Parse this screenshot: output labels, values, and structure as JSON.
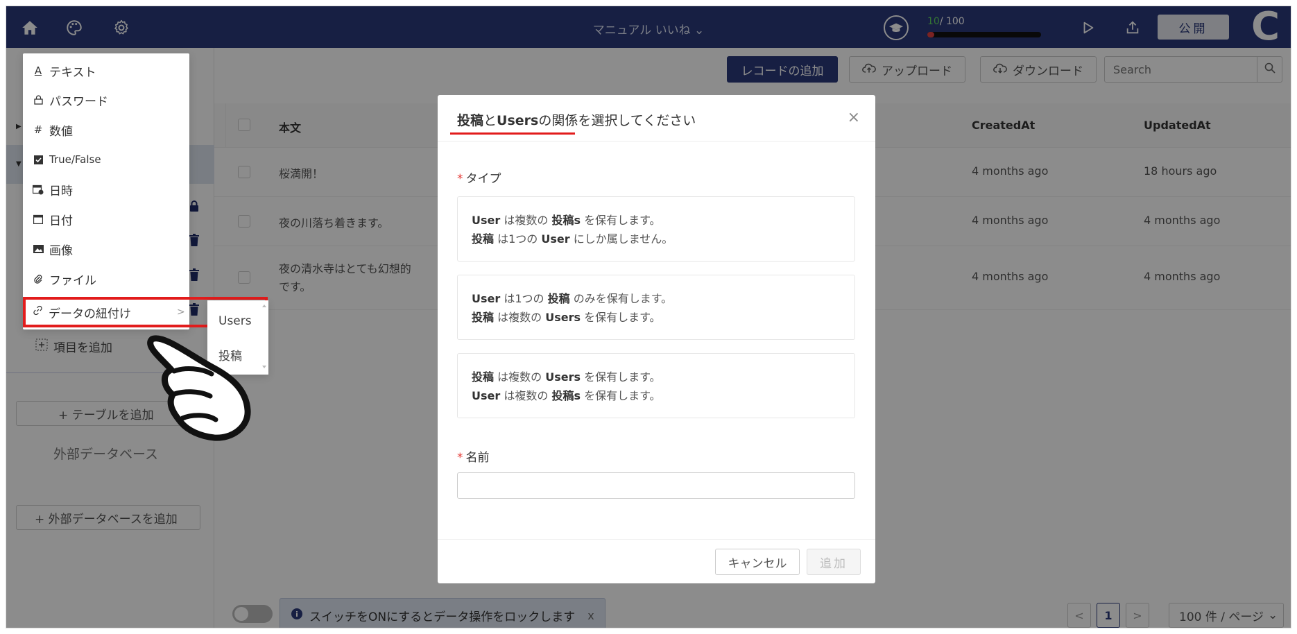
{
  "topbar": {
    "project_title": "マニュアル いいね ⌄",
    "progress": {
      "current": "10",
      "total": "/ 100",
      "fraction": 0.06
    },
    "publish_label": "公開",
    "logo": "C"
  },
  "type_menu": {
    "items": [
      {
        "icon": "text-icon",
        "glyph": "A",
        "label": "テキスト"
      },
      {
        "icon": "lock-icon",
        "glyph": "🔒",
        "label": "パスワード"
      },
      {
        "icon": "hash-icon",
        "glyph": "#",
        "label": "数値"
      },
      {
        "icon": "checkbox-icon",
        "glyph": "☑",
        "label": "True/False"
      },
      {
        "icon": "calendar-clock-icon",
        "glyph": "📅",
        "label": "日時"
      },
      {
        "icon": "calendar-icon",
        "glyph": "📅",
        "label": "日付"
      },
      {
        "icon": "image-icon",
        "glyph": "▣",
        "label": "画像"
      },
      {
        "icon": "paperclip-icon",
        "glyph": "📎",
        "label": "ファイル"
      }
    ],
    "link_item": {
      "label": "データの紐付け",
      "chevron": ">"
    },
    "sub_items": [
      "Users",
      "投稿"
    ]
  },
  "sidebar": {
    "add_item_label": "項目を追加",
    "add_table_label": "+ テーブルを追加",
    "external_db_label": "外部データベース",
    "add_external_db_label": "+ 外部データベースを追加"
  },
  "toolbar": {
    "add_record_label": "レコードの追加",
    "upload_label": "アップロード",
    "download_label": "ダウンロード",
    "search_placeholder": "Search"
  },
  "table": {
    "columns": [
      "本文",
      "CreatedAt",
      "UpdatedAt"
    ],
    "rows": [
      {
        "body": "桜満開！",
        "created": "4 months ago",
        "updated": "18 hours ago"
      },
      {
        "body": "夜の川落ち着きます。",
        "created": "4 months ago",
        "updated": "4 months ago"
      },
      {
        "body": "夜の清水寺はとても幻想的です。",
        "body_line1": "夜の清水寺はとても幻想的",
        "body_line2": "です。",
        "created": "4 months ago",
        "updated": "4 months ago"
      }
    ]
  },
  "footer": {
    "lock_alert": "スイッチをONにするとデータ操作をロックします",
    "alert_close": "x",
    "page_current": "1",
    "page_prev": "<",
    "page_next": ">",
    "page_size": "100 件 / ページ",
    "page_size_chevron": "⌄"
  },
  "modal": {
    "title_part1": "投稿",
    "title_part2": "と",
    "title_part3": "Users",
    "title_part4": "の関係を選択してください",
    "close": "×",
    "type_label": "タイプ",
    "required_mark": "*",
    "options": [
      [
        [
          {
            "b": "User"
          },
          {
            "t": " は複数の "
          },
          {
            "b": "投稿s"
          },
          {
            "t": " を保有します。"
          }
        ],
        [
          {
            "b": "投稿"
          },
          {
            "t": " は1つの "
          },
          {
            "b": "User"
          },
          {
            "t": " にしか属しません。"
          }
        ]
      ],
      [
        [
          {
            "b": "User"
          },
          {
            "t": " は1つの "
          },
          {
            "b": "投稿"
          },
          {
            "t": " のみを保有します。"
          }
        ],
        [
          {
            "b": "投稿"
          },
          {
            "t": " は複数の "
          },
          {
            "b": "Users"
          },
          {
            "t": " を保有します。"
          }
        ]
      ],
      [
        [
          {
            "b": "投稿"
          },
          {
            "t": " は複数の "
          },
          {
            "b": "Users"
          },
          {
            "t": " を保有します。"
          }
        ],
        [
          {
            "b": "User"
          },
          {
            "t": " は複数の "
          },
          {
            "b": "投稿s"
          },
          {
            "t": " を保有します。"
          }
        ]
      ]
    ],
    "name_label": "名前",
    "name_value": "",
    "cancel_label": "キャンセル",
    "add_label": "追加"
  },
  "colors": {
    "navy": "#2b3a7a",
    "highlight_red": "#e21c1c",
    "required_red": "#e53935",
    "progress_green": "#5fd35f"
  }
}
